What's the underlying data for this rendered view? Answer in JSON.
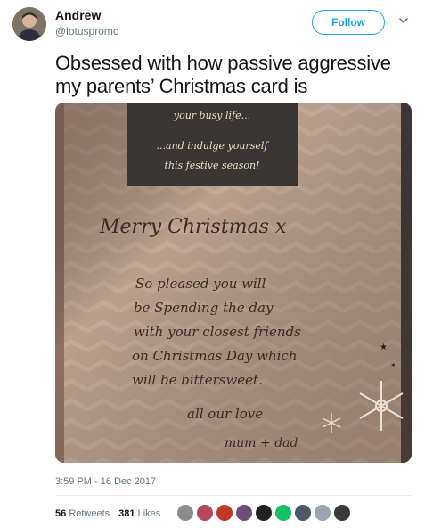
{
  "user": {
    "name": "Andrew",
    "handle": "@lotuspromo"
  },
  "follow_label": "Follow",
  "tweet_text": "Obsessed with how passive aggressive my parents’ Christmas card is",
  "card": {
    "box_lines": [
      "your busy life...",
      "...and indulge yourself",
      "this festive season!"
    ],
    "greeting": "Merry Christmas x",
    "message_lines": [
      "So pleased you will",
      "be Spending the day",
      "with your closest friends",
      "on Christmas Day which",
      "will be bittersweet."
    ],
    "sign_off": [
      "all our love",
      "mum + dad"
    ]
  },
  "timestamp": "3:59 PM - 16 Dec 2017",
  "stats": {
    "retweets_count": "56",
    "retweets_label": "Retweets",
    "likes_count": "381",
    "likes_label": "Likes"
  },
  "liker_avatars": [
    {
      "name": "liker-avatar-1",
      "color": "#8d8d8d"
    },
    {
      "name": "liker-avatar-2",
      "color": "#b5495b"
    },
    {
      "name": "liker-avatar-3",
      "color": "#c0392b"
    },
    {
      "name": "liker-avatar-4",
      "color": "#6b4f7a"
    },
    {
      "name": "liker-avatar-5",
      "color": "#222222"
    },
    {
      "name": "liker-avatar-6",
      "color": "#17bf63"
    },
    {
      "name": "liker-avatar-7",
      "color": "#4a5a6a"
    },
    {
      "name": "liker-avatar-8",
      "color": "#9aa5b1"
    },
    {
      "name": "liker-avatar-9",
      "color": "#3a3a3a"
    }
  ],
  "colors": {
    "accent": "#1da1f2",
    "secondary_text": "#657786",
    "photo_card": "#b59a86",
    "photo_box": "#3a3633"
  }
}
